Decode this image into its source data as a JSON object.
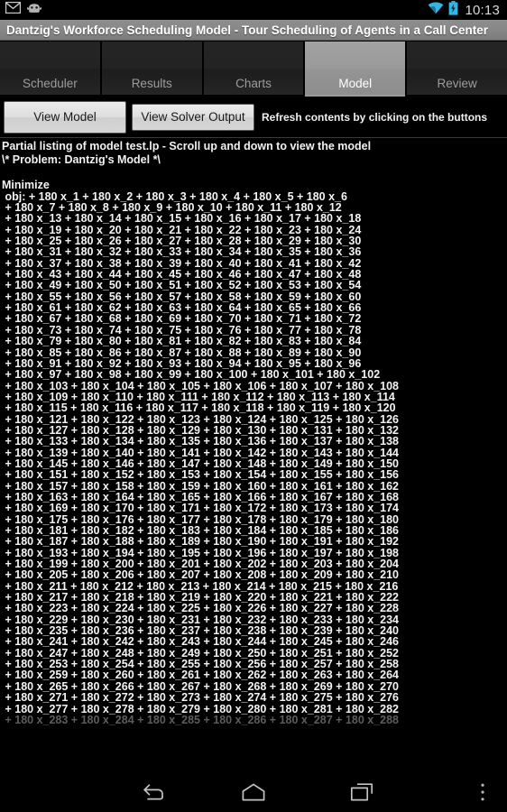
{
  "statusbar": {
    "clock": "10:13",
    "icons": {
      "mail": "mail-icon",
      "robot": "android-robot-icon",
      "wifi": "wifi-icon",
      "battery": "battery-charging-icon"
    },
    "accent_color": "#33b5e5"
  },
  "titlebar": {
    "title": "Dantzig's Workforce Scheduling Model - Tour Scheduling of Agents in a Call Center",
    "background_color": "#8a8a8a",
    "text_color": "#ffffff"
  },
  "tabs": {
    "selected_index": 3,
    "items": [
      {
        "label": "Scheduler"
      },
      {
        "label": "Results"
      },
      {
        "label": "Charts"
      },
      {
        "label": "Model"
      },
      {
        "label": "Review"
      }
    ],
    "selected_bg": "#9a9a9a",
    "unselected_bg": "#232323",
    "unselected_text": "#9d9d9d"
  },
  "toolbar": {
    "view_model_label": "View Model",
    "view_solver_label": "View Solver Output",
    "hint": "Refresh contents by clicking on the buttons"
  },
  "content": {
    "header_line_1": "Partial listing of model test.lp - Scroll up and down to view the model",
    "header_line_2": "\\* Problem: Dantzig's Model *\\",
    "section_label": "Minimize",
    "objective_prefix": "obj:",
    "coefficient": 180,
    "variable_prefix": "x_",
    "terms_per_line": 6,
    "first_variable": 1,
    "last_variable": 288,
    "faded_last_line": true,
    "text_color": "#f4f4f4",
    "faded_color": "#5d5d5d",
    "background_color": "#000000"
  },
  "navbar": {
    "items": [
      {
        "name": "back-icon",
        "label": "Back"
      },
      {
        "name": "home-icon",
        "label": "Home"
      },
      {
        "name": "recents-icon",
        "label": "Recent apps"
      },
      {
        "name": "overflow-menu-icon",
        "label": "More options"
      }
    ]
  }
}
